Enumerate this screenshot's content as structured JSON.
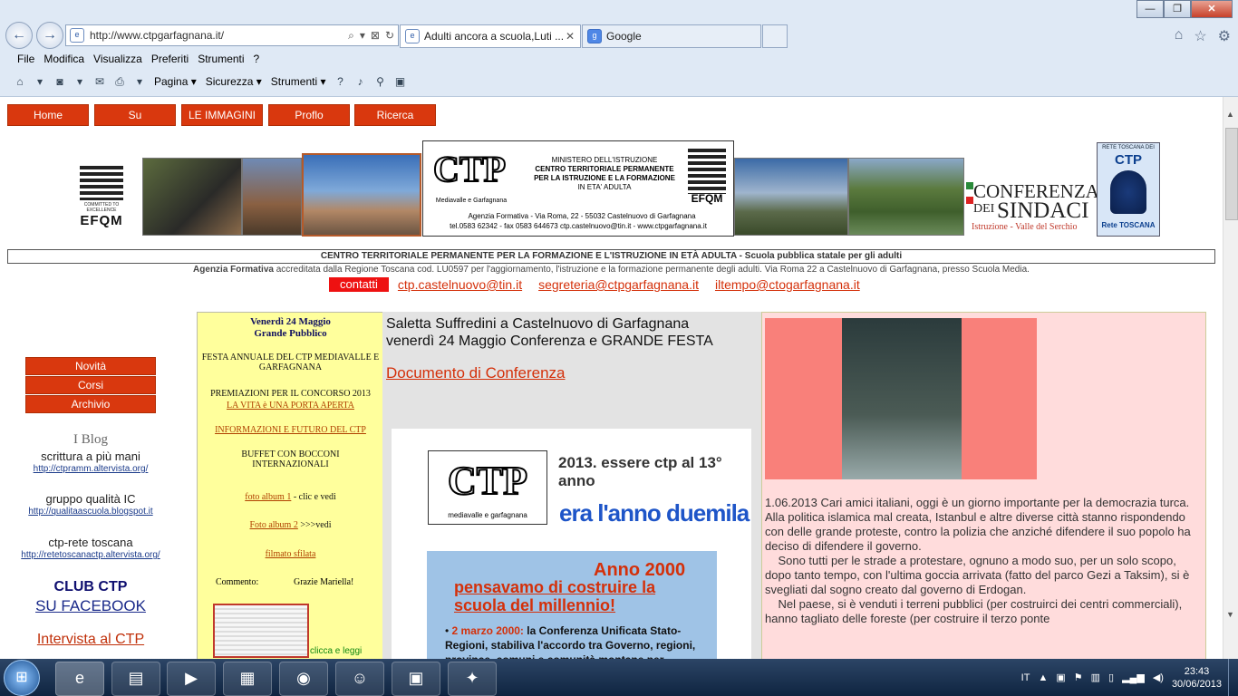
{
  "browser": {
    "window_controls": {
      "minimize": "—",
      "maximize": "❐",
      "close": "✕"
    },
    "address": "http://www.ctpgarfagnana.it/",
    "address_tools": [
      "⌕",
      "▾",
      "⊠",
      "↻"
    ],
    "tabs": [
      {
        "label": "Adulti ancora a scuola,Luti ...",
        "close": "✕"
      },
      {
        "label": "Google"
      }
    ],
    "menu": [
      "File",
      "Modifica",
      "Visualizza",
      "Preferiti",
      "Strumenti",
      "?"
    ],
    "toolbar": {
      "pagina": "Pagina ▾",
      "sicurezza": "Sicurezza ▾",
      "strumenti": "Strumenti ▾"
    }
  },
  "site": {
    "nav": [
      "Home",
      "Su",
      "LE IMMAGINI",
      "Proflo",
      "Ricerca"
    ],
    "header": {
      "efqm_top": "COMMITTED TO EXCELLENCE",
      "efqm_bottom": "EFQM",
      "ctp_logo": "CTP",
      "ctp_sub": "Mediavalle e Garfagnana",
      "ministry_lines": [
        "MINISTERO DELL'ISTRUZIONE",
        "CENTRO TERRITORIALE PERMANENTE",
        "PER LA ISTRUZIONE E LA FORMAZIONE",
        "IN ETA' ADULTA"
      ],
      "agency_line": "Agenzia Formativa - Via Roma, 22 - 55032 Castelnuovo di Garfagnana",
      "contacts_line": "tel.0583 62342 - fax 0583 644673  ctp.castelnuovo@tin.it - www.ctpgarfagnana.it",
      "conferenza_1": "CONFERENZA",
      "conferenza_dei": "DEI",
      "conferenza_2": "SINDACI",
      "conferenza_sub": "Istruzione - Valle del Serchio",
      "rete_top": "RETE TOSCANA DEI",
      "rete_ctp": "CTP",
      "rete_bottom": "Rete TOSCANA"
    },
    "banner": "CENTRO TERRITORIALE PERMANENTE  PER  LA FORMAZIONE  E  L'ISTRUZIONE IN ETÀ ADULTA  - Scuola pubblica statale per gli adulti",
    "agency": {
      "bold": "Agenzia Formativa",
      "text": " accreditata dalla Regione Toscana cod. LU0597  per l'aggiornamento, l'istruzione e la formazione permanente degli adulti. Via Roma 22 a Castelnuovo di Garfagnana, presso Scuola  Media."
    },
    "contacts_label": "contatti",
    "emails": [
      "ctp.castelnuovo@tin.it",
      "segreteria@ctpgarfagnana.it",
      "iltempo@ctogarfagnana.it"
    ],
    "side_menu": [
      "Novità",
      "Corsi",
      "Archivio"
    ],
    "blog_head": "I Blog",
    "blogs": [
      {
        "title": "scrittura a più mani",
        "url": "http://ctpramm.altervista.org/"
      },
      {
        "title": "gruppo qualità IC",
        "url": "http://qualitaascuola.blogspot.it"
      },
      {
        "title": "ctp-rete toscana",
        "url": "http://retetoscanactp.altervista.org/"
      }
    ],
    "club_1": "CLUB CTP",
    "club_2": "SU FACEBOOK",
    "interview": "Intervista al CTP",
    "yellow": {
      "date": "Venerdì 24 Maggio",
      "public": "Grande Pubblico",
      "festa": "FESTA  ANNUALE DEL CTP MEDIAVALLE E  GARFAGNANA",
      "premiazioni": "PREMIAZIONI PER IL  CONCORSO 2013",
      "vita": "LA VITA è UNA PORTA APERTA",
      "info": "INFORMAZIONI E FUTURO  DEL CTP",
      "buffet": "BUFFET  CON BOCCONI INTERNAZIONALI",
      "album1": "foto album 1",
      "album1_rest": " - clic e vedi",
      "album2": "Foto album 2",
      "album2_rest": "  >>>vedi",
      "filmato": "filmato sfilata",
      "commento": "Commento:",
      "grazie": "Grazie Mariella!",
      "clicca": "clicca e leggi"
    },
    "middle": {
      "title_1": "Saletta Suffredini a Castelnuovo di Garfagnana",
      "title_2": "venerdì 24 Maggio Conferenza e GRANDE FESTA",
      "doc_link": "Documento di Conferenza",
      "poster_title": "2013. essere ctp al 13° anno",
      "poster_ctp": "CTP",
      "poster_ctp_sub": "mediavalle e garfagnana",
      "poster_sub": "era l'anno duemila",
      "p2_year": "Anno 2000",
      "p2_headline": "pensavamo di costruire la scuola del millennio!",
      "p2_bullet": "2 marzo 2000:",
      "p2_bullet_rest": " la Conferenza Unificata Stato-Regioni, stabiliva l'accordo tra Governo, regioni, province, comuni e comunità montane per"
    },
    "article": [
      "1.06.2013    Cari amici italiani, oggi è un giorno importante per la democrazia turca.",
      "Alla politica islamica mal creata, Istanbul e altre diverse città stanno rispondendo con delle grande proteste, contro la polizia che anziché difendere il suo popolo ha deciso di difendere il governo.",
      "    Sono tutti per le strade a protestare, ognuno a modo suo, per un solo scopo, dopo tanto tempo, con l'ultima goccia arrivata (fatto del parco Gezi a Taksim), si è svegliati dal sogno creato dal governo di Erdogan.",
      "    Nel paese, si è venduti i terreni pubblici (per costruirci dei centri commerciali), hanno tagliato delle foreste (per costruire il terzo ponte"
    ]
  },
  "taskbar": {
    "lang": "IT",
    "time": "23:43",
    "date": "30/06/2013"
  }
}
